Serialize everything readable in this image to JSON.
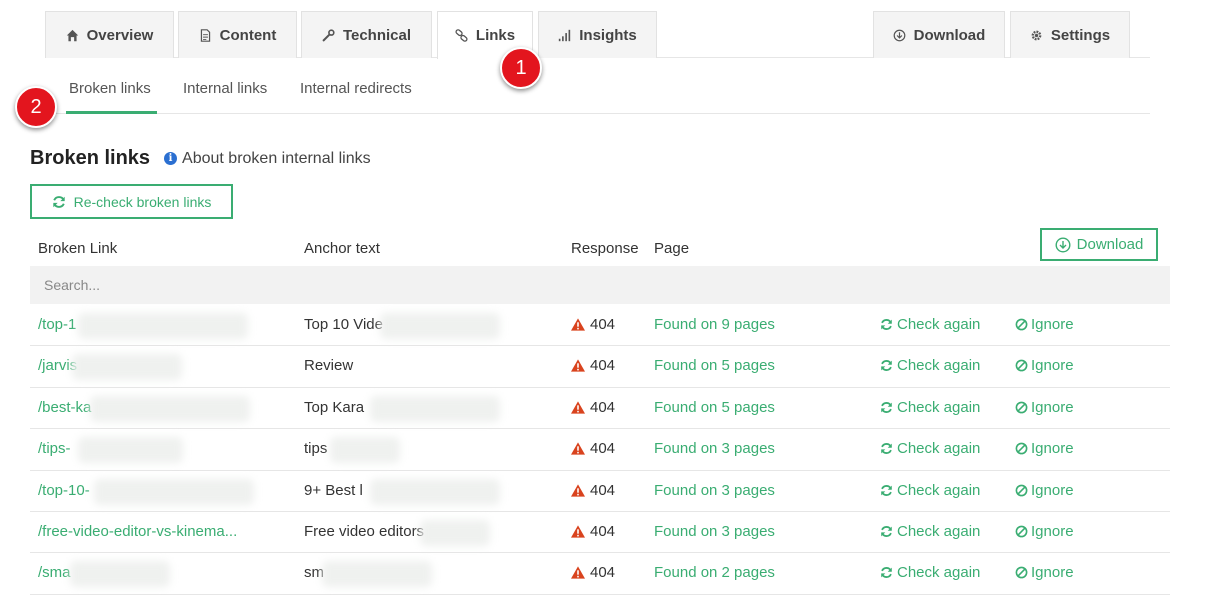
{
  "tabs": [
    {
      "label": "Overview",
      "icon": "home-icon"
    },
    {
      "label": "Content",
      "icon": "document-icon"
    },
    {
      "label": "Technical",
      "icon": "wrench-icon"
    },
    {
      "label": "Links",
      "icon": "link-icon",
      "active": true
    },
    {
      "label": "Insights",
      "icon": "signal-bars-icon"
    },
    {
      "label": "Download",
      "icon": "download-circle-icon"
    },
    {
      "label": "Settings",
      "icon": "gear-icon"
    }
  ],
  "markers": [
    "1",
    "2"
  ],
  "subtabs": [
    {
      "label": "Broken links",
      "active": true
    },
    {
      "label": "Internal links"
    },
    {
      "label": "Internal redirects"
    }
  ],
  "section": {
    "title": "Broken links",
    "about_link": "About broken internal links",
    "recheck_label": "Re-check broken links"
  },
  "table": {
    "headers": {
      "broken_link": "Broken Link",
      "anchor_text": "Anchor text",
      "response": "Response",
      "page": "Page"
    },
    "download_label": "Download",
    "search_placeholder": "Search...",
    "rows": [
      {
        "link": "/top-1",
        "anchor": "Top 10 Vide",
        "response": "404",
        "page": "Found on 9 pages",
        "check": "Check again",
        "ignore": "Ignore"
      },
      {
        "link": "/jarvis",
        "anchor": "Review",
        "response": "404",
        "page": "Found on 5 pages",
        "check": "Check again",
        "ignore": "Ignore"
      },
      {
        "link": "/best-ka",
        "anchor": "Top Kara",
        "response": "404",
        "page": "Found on 5 pages",
        "check": "Check again",
        "ignore": "Ignore"
      },
      {
        "link": "/tips-",
        "anchor": "tips",
        "response": "404",
        "page": "Found on 3 pages",
        "check": "Check again",
        "ignore": "Ignore"
      },
      {
        "link": "/top-10-",
        "anchor": "9+ Best l",
        "response": "404",
        "page": "Found on 3 pages",
        "check": "Check again",
        "ignore": "Ignore"
      },
      {
        "link": "/free-video-editor-vs-kinema...",
        "anchor": "Free video editors",
        "response": "404",
        "page": "Found on 3 pages",
        "check": "Check again",
        "ignore": "Ignore"
      },
      {
        "link": "/sma",
        "anchor": "sm",
        "response": "404",
        "page": "Found on 2 pages",
        "check": "Check again",
        "ignore": "Ignore"
      }
    ]
  },
  "colors": {
    "accent": "#3aad72",
    "marker": "#e3151e",
    "warning": "#d9431e",
    "info": "#2b6fd1"
  }
}
